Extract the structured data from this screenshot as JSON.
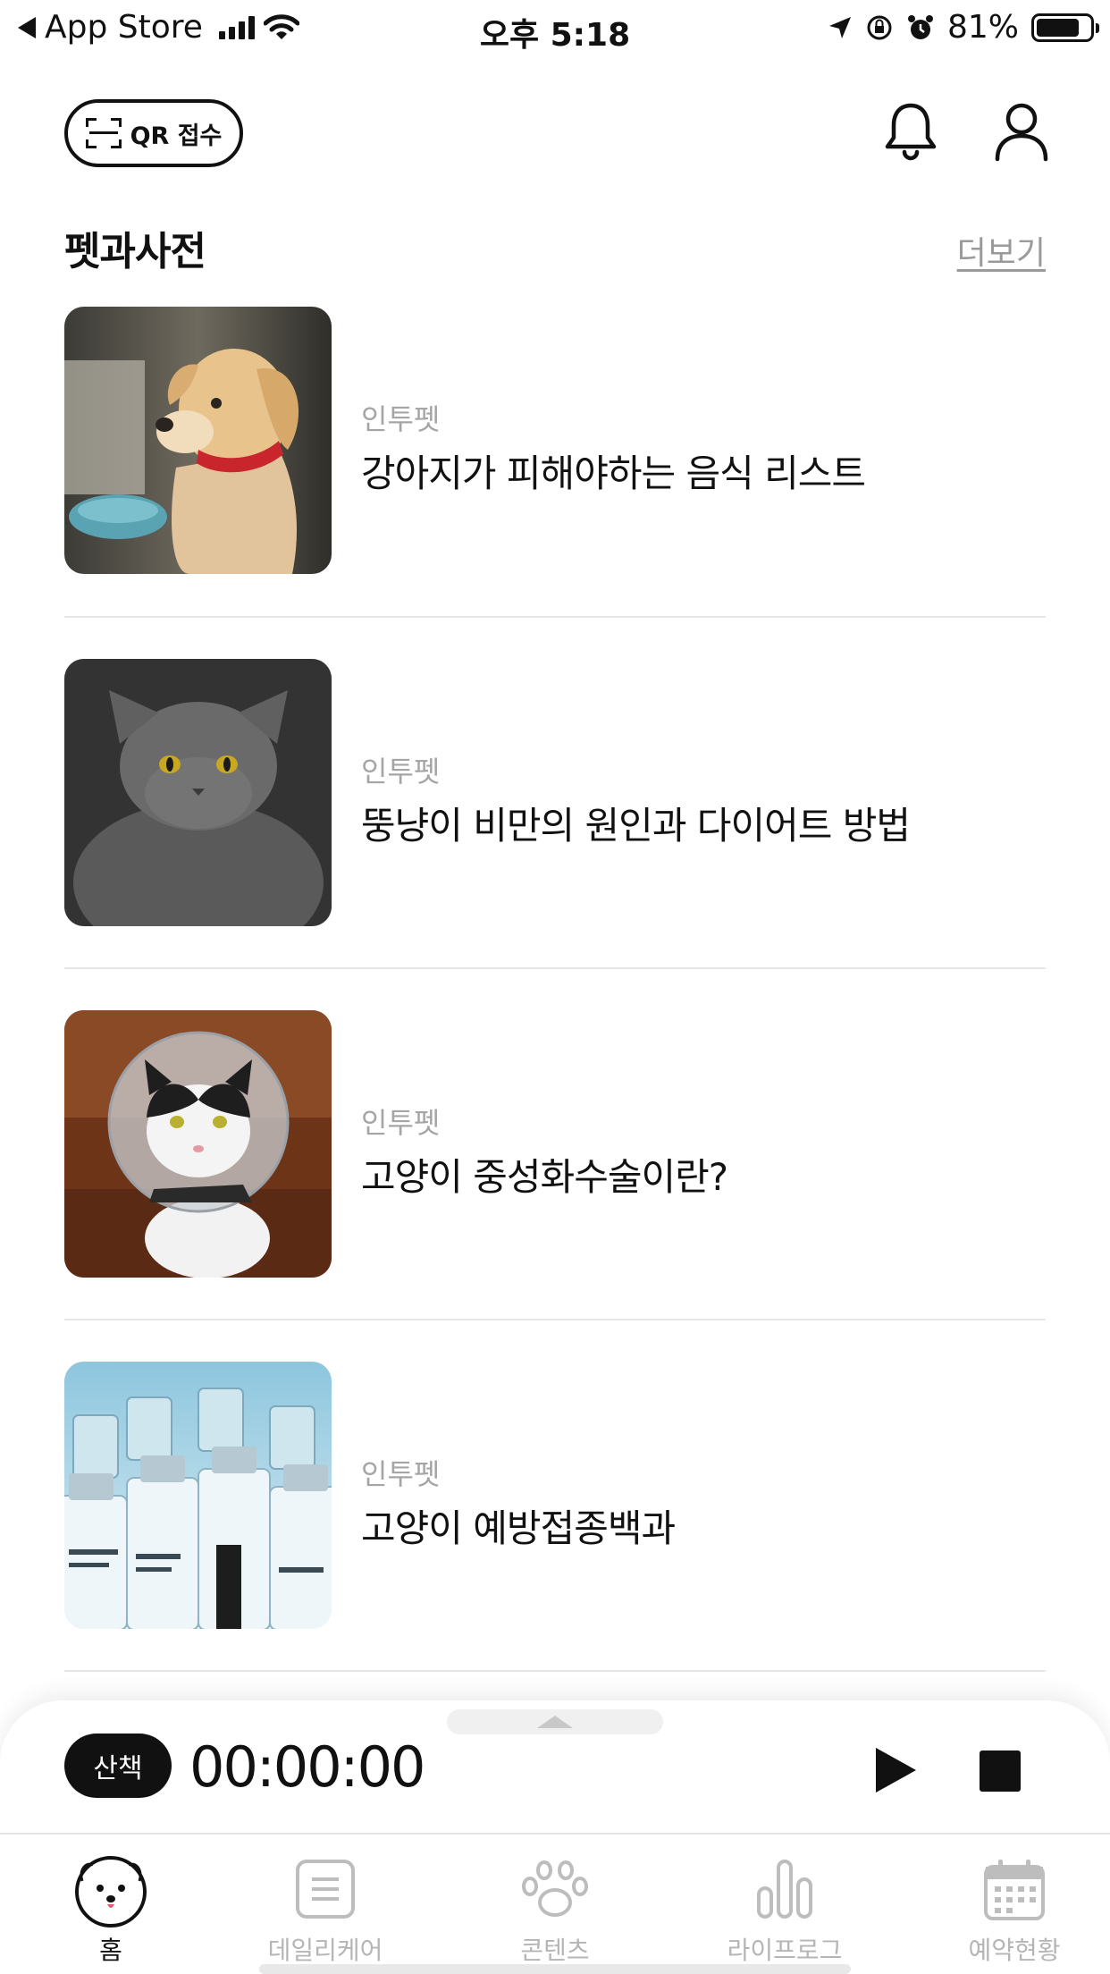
{
  "status_bar": {
    "back_app": "App Store",
    "time": "오후 5:18",
    "battery_percent": "81%",
    "battery_level": 0.81
  },
  "header": {
    "qr_label": "QR 접수",
    "icons": [
      "qr-scan-icon",
      "bell-icon",
      "user-icon"
    ]
  },
  "section": {
    "title": "펫과사전",
    "more_label": "더보기"
  },
  "articles": [
    {
      "source": "인투펫",
      "title": "강아지가 피해야하는 음식 리스트",
      "thumbnail": "puppy-photo"
    },
    {
      "source": "인투펫",
      "title": "뚱냥이 비만의 원인과 다이어트 방법",
      "thumbnail": "gray-cat-photo"
    },
    {
      "source": "인투펫",
      "title": "고양이 중성화수술이란?",
      "thumbnail": "cat-with-cone-photo"
    },
    {
      "source": "인투펫",
      "title": "고양이 예방접종백과",
      "thumbnail": "vaccine-vials-photo"
    }
  ],
  "player": {
    "mode_label": "산책",
    "timer": "00:00:00",
    "controls": [
      "play-icon",
      "stop-icon"
    ]
  },
  "tab_bar": {
    "tabs": [
      {
        "label": "홈",
        "icon": "pet-face-icon",
        "active": true
      },
      {
        "label": "데일리케어",
        "icon": "document-icon",
        "active": false
      },
      {
        "label": "콘텐츠",
        "icon": "paw-icon",
        "active": false
      },
      {
        "label": "라이프로그",
        "icon": "bar-chart-icon",
        "active": false
      },
      {
        "label": "예약현황",
        "icon": "calendar-icon",
        "active": false
      }
    ]
  },
  "colors": {
    "text": "#111111",
    "muted": "#a5a5a5",
    "divider": "#e6e6e6",
    "inactive_tab": "#b5b5b5"
  }
}
